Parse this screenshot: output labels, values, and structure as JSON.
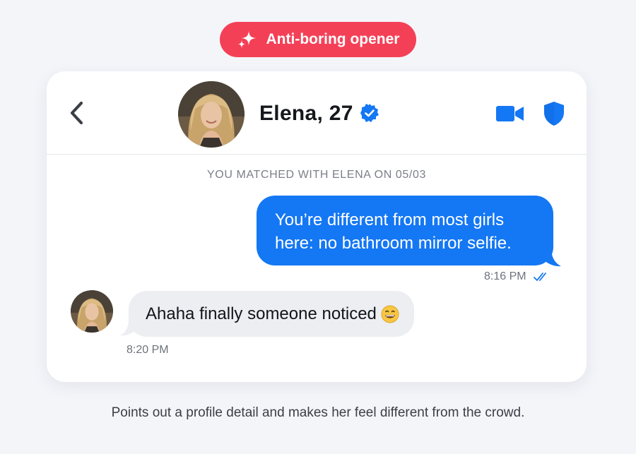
{
  "badge": {
    "label": "Anti-boring opener",
    "icon": "sparkle-icon",
    "color": "#f44057"
  },
  "header": {
    "name": "Elena, 27",
    "verified_icon": "verified-badge-icon",
    "actions": [
      "video-call-icon",
      "shield-icon"
    ],
    "accent": "#1477f4"
  },
  "chat": {
    "matched_notice": "YOU MATCHED WITH ELENA ON 05/03",
    "messages": [
      {
        "from": "me",
        "line1": "You’re different from most girls",
        "line2": "here: no bathroom mirror selfie.",
        "time": "8:16 PM",
        "status_icon": "double-check-icon"
      },
      {
        "from": "elena",
        "text": "Ahaha finally someone noticed",
        "emoji": "grinning-face-icon",
        "time": "8:20 PM"
      }
    ]
  },
  "caption": "Points out a profile detail and makes her feel different from the crowd."
}
